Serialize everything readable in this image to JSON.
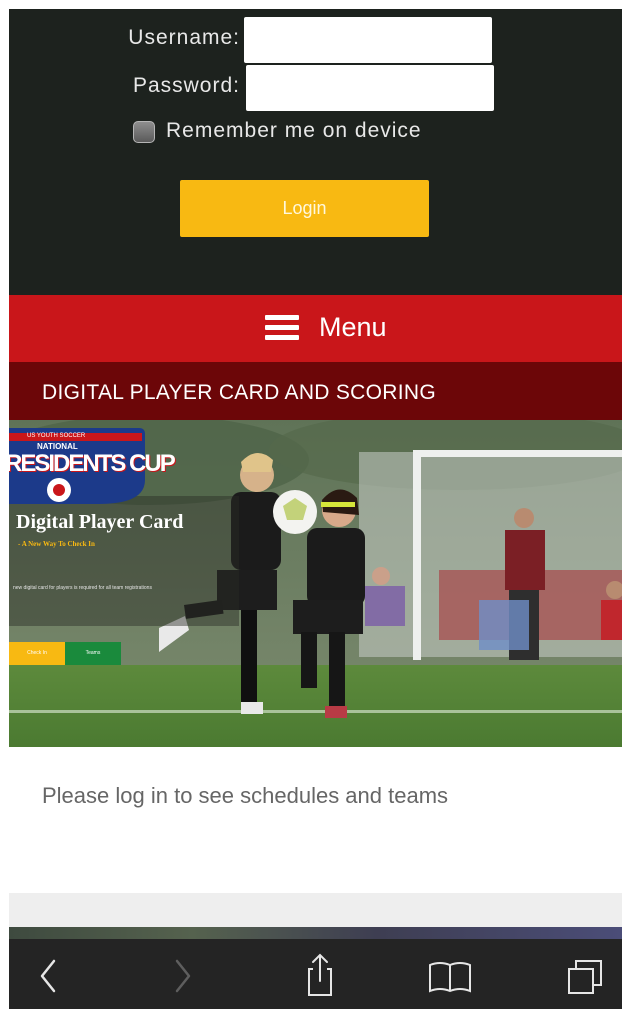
{
  "login_form": {
    "username_label": "Username:",
    "username_value": "",
    "password_label": "Password:",
    "password_value": "",
    "remember_label": "Remember me on device",
    "remember_checked": false,
    "login_button_label": "Login"
  },
  "menu": {
    "label": "Menu",
    "icon": "hamburger-icon"
  },
  "section": {
    "title": "DIGITAL PLAYER CARD AND SCORING"
  },
  "banner": {
    "logo_text_top": "US YOUTH SOCCER",
    "logo_text_national": "NATIONAL",
    "logo_text_main": "RESIDENTS CUP",
    "headline": "Digital Player Card",
    "tagline": "- A New Way To Check In",
    "caption": "new digital card for players is required for all team registrations",
    "button_1_label": "Check In",
    "button_2_label": "Teams"
  },
  "message": "Please log in to see schedules and teams",
  "browser_toolbar": {
    "icons": [
      "back-icon",
      "forward-icon",
      "share-icon",
      "bookmarks-icon",
      "tabs-icon"
    ]
  },
  "colors": {
    "login_panel": "#1d221e",
    "login_button": "#f8b912",
    "menu_bar": "#c9161a",
    "section_bar": "#6c0608",
    "toolbar": "#242424"
  }
}
